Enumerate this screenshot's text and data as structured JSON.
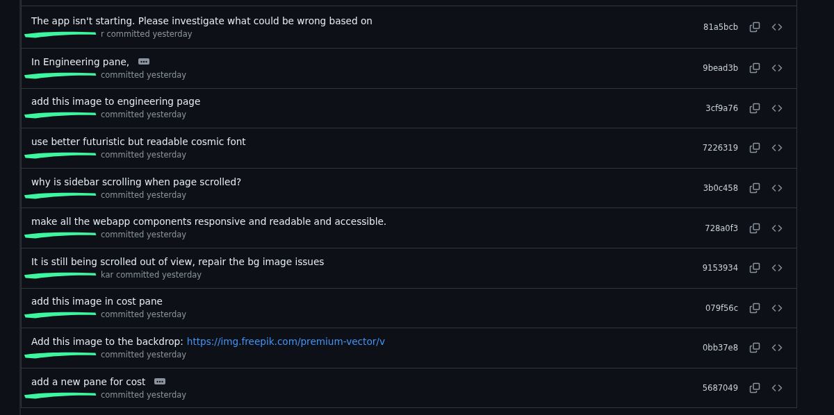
{
  "commits": [
    {
      "message": "The app isn't starting. Please investigate what could be wrong based on",
      "expandable": false,
      "meta": "r committed yesterday",
      "sha": "81a5bcb"
    },
    {
      "message": "In Engineering pane,",
      "expandable": true,
      "meta": "committed yesterday",
      "sha": "9bead3b"
    },
    {
      "message": "add this image to engineering page",
      "expandable": false,
      "meta": "committed yesterday",
      "sha": "3cf9a76"
    },
    {
      "message": "use better futuristic but readable cosmic font",
      "expandable": false,
      "meta": "committed yesterday",
      "sha": "7226319"
    },
    {
      "message": "why is sidebar scrolling when page scrolled?",
      "expandable": false,
      "meta": "committed yesterday",
      "sha": "3b0c458"
    },
    {
      "message": "make all the webapp components responsive and readable and accessible.",
      "expandable": false,
      "meta": "committed yesterday",
      "sha": "728a0f3"
    },
    {
      "message": "It is still being scrolled out of view, repair the bg image issues",
      "expandable": false,
      "meta": "kar committed yesterday",
      "sha": "9153934"
    },
    {
      "message": "add this image in cost pane",
      "expandable": false,
      "meta": "committed yesterday",
      "sha": "079f56c"
    },
    {
      "message": "Add this image to the backdrop:",
      "link": "https://img.freepik.com/premium-vector/v",
      "expandable": false,
      "meta": "committed yesterday",
      "sha": "0bb37e8"
    },
    {
      "message": "add a new pane for cost",
      "expandable": true,
      "meta": "committed yesterday",
      "sha": "5687049"
    }
  ]
}
